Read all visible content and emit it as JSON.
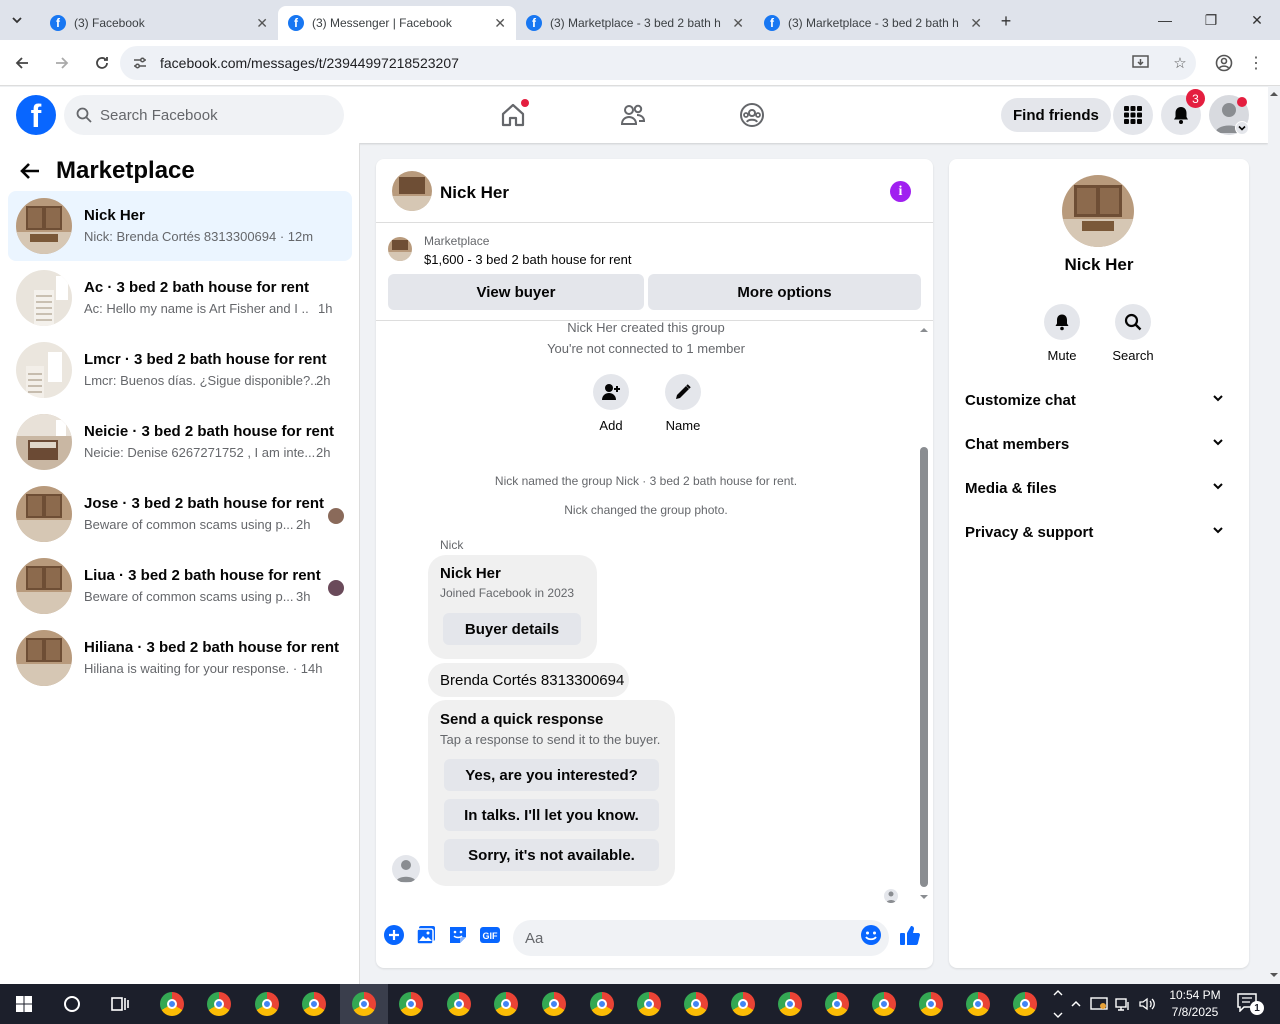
{
  "browser": {
    "tabs": [
      {
        "title": "(3) Facebook"
      },
      {
        "title": "(3) Messenger | Facebook"
      },
      {
        "title": "(3) Marketplace - 3 bed 2 bath h"
      },
      {
        "title": "(3) Marketplace - 3 bed 2 bath h"
      }
    ],
    "url": "facebook.com/messages/t/23944997218523207"
  },
  "header": {
    "search_placeholder": "Search Facebook",
    "find_friends": "Find friends",
    "notifications_count": "3"
  },
  "sidebar": {
    "title": "Marketplace",
    "conversations": [
      {
        "name": "Nick Her",
        "preview": "Nick: Brenda Cortés 8313300694 · 12m"
      },
      {
        "name": "Ac · 3 bed 2 bath house for rent",
        "preview": "Ac: Hello my name is Art Fisher and I ...",
        "time": "1h"
      },
      {
        "name": "Lmcr · 3 bed 2 bath house for rent",
        "preview": "Lmcr: Buenos días. ¿Sigue disponible?...",
        "time": "2h"
      },
      {
        "name": "Neicie · 3 bed 2 bath house for rent",
        "preview": "Neicie: Denise 6267271752 , I am inte...",
        "time": "2h"
      },
      {
        "name": "Jose · 3 bed 2 bath house for rent",
        "preview": "Beware of common scams using p...",
        "time": "2h"
      },
      {
        "name": "Liua · 3 bed 2 bath house for rent",
        "preview": "Beware of common scams using p...",
        "time": "3h"
      },
      {
        "name": "Hiliana · 3 bed 2 bath house for rent",
        "preview": "Hiliana is waiting for your response. · 14h"
      }
    ]
  },
  "chat": {
    "name": "Nick Her",
    "marketplace_label": "Marketplace",
    "listing": "$1,600 - 3 bed 2 bath house for rent",
    "view_buyer": "View buyer",
    "more_options": "More options",
    "sys_created": "Nick Her created this group",
    "sys_connected": "You're not connected to 1 member",
    "add_label": "Add",
    "name_label": "Name",
    "sys_named": "Nick named the group Nick · 3 bed 2 bath house for rent.",
    "sys_photo": "Nick changed the group photo.",
    "sender": "Nick",
    "card_name": "Nick Her",
    "card_joined": "Joined Facebook in 2023",
    "buyer_details": "Buyer details",
    "message": "Brenda Cortés 8313300694",
    "quick_title": "Send a quick response",
    "quick_sub": "Tap a response to send it to the buyer.",
    "quick_responses": [
      "Yes, are you interested?",
      "In talks. I'll let you know.",
      "Sorry, it's not available."
    ],
    "input_placeholder": "Aa"
  },
  "info_panel": {
    "name": "Nick Her",
    "mute": "Mute",
    "search": "Search",
    "sections": [
      "Customize chat",
      "Chat members",
      "Media & files",
      "Privacy & support"
    ]
  },
  "taskbar": {
    "time": "10:54 PM",
    "date": "7/8/2025",
    "notif_count": "1"
  },
  "colors": {
    "brand": "#0866ff",
    "info_icon": "#a020f0",
    "badge": "#e41e3f"
  }
}
